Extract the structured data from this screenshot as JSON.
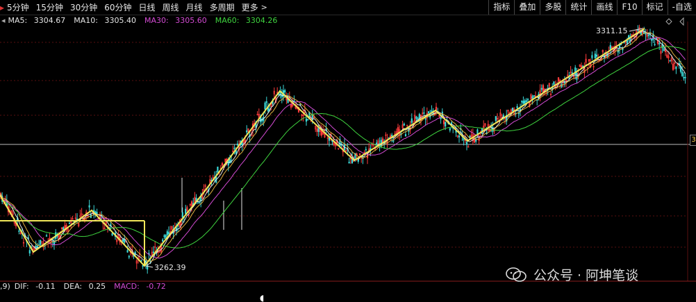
{
  "toolbar": {
    "periods": [
      "5分钟",
      "15分钟",
      "30分钟",
      "60分钟",
      "日线",
      "周线",
      "月线",
      "多周期",
      "更多"
    ],
    "tools": [
      "指标",
      "叠加",
      "多股",
      "统计",
      "画线",
      "F10",
      "标记",
      "-自选"
    ]
  },
  "indicators": {
    "ma5": {
      "label": "MA5:",
      "value": "3304.67",
      "color": "#e6e6e6"
    },
    "ma10": {
      "label": "MA10:",
      "value": "3305.40",
      "color": "#e6e6e6"
    },
    "ma30": {
      "label": "MA30:",
      "value": "3305.60",
      "color": "#d44bd4"
    },
    "ma60": {
      "label": "MA60:",
      "value": "3304.26",
      "color": "#3fd43f"
    }
  },
  "macd": {
    "prefix": ",9)",
    "dif": {
      "label": "DIF:",
      "value": "-0.11",
      "color": "#e6e6e6"
    },
    "dea": {
      "label": "DEA:",
      "value": "0.25",
      "color": "#e6e6e6"
    },
    "macd": {
      "label": "MACD:",
      "value": "-0.72",
      "color": "#d44bd4"
    }
  },
  "chart": {
    "high_label": "3311.15",
    "low_label": "3262.39",
    "price_tag": "3",
    "zigzag_color": "#f2e85a",
    "up_color": "#ff3b3b",
    "down_color": "#3bd8d8"
  },
  "watermark": {
    "text": "公众号 · 阿坤笔谈"
  }
}
